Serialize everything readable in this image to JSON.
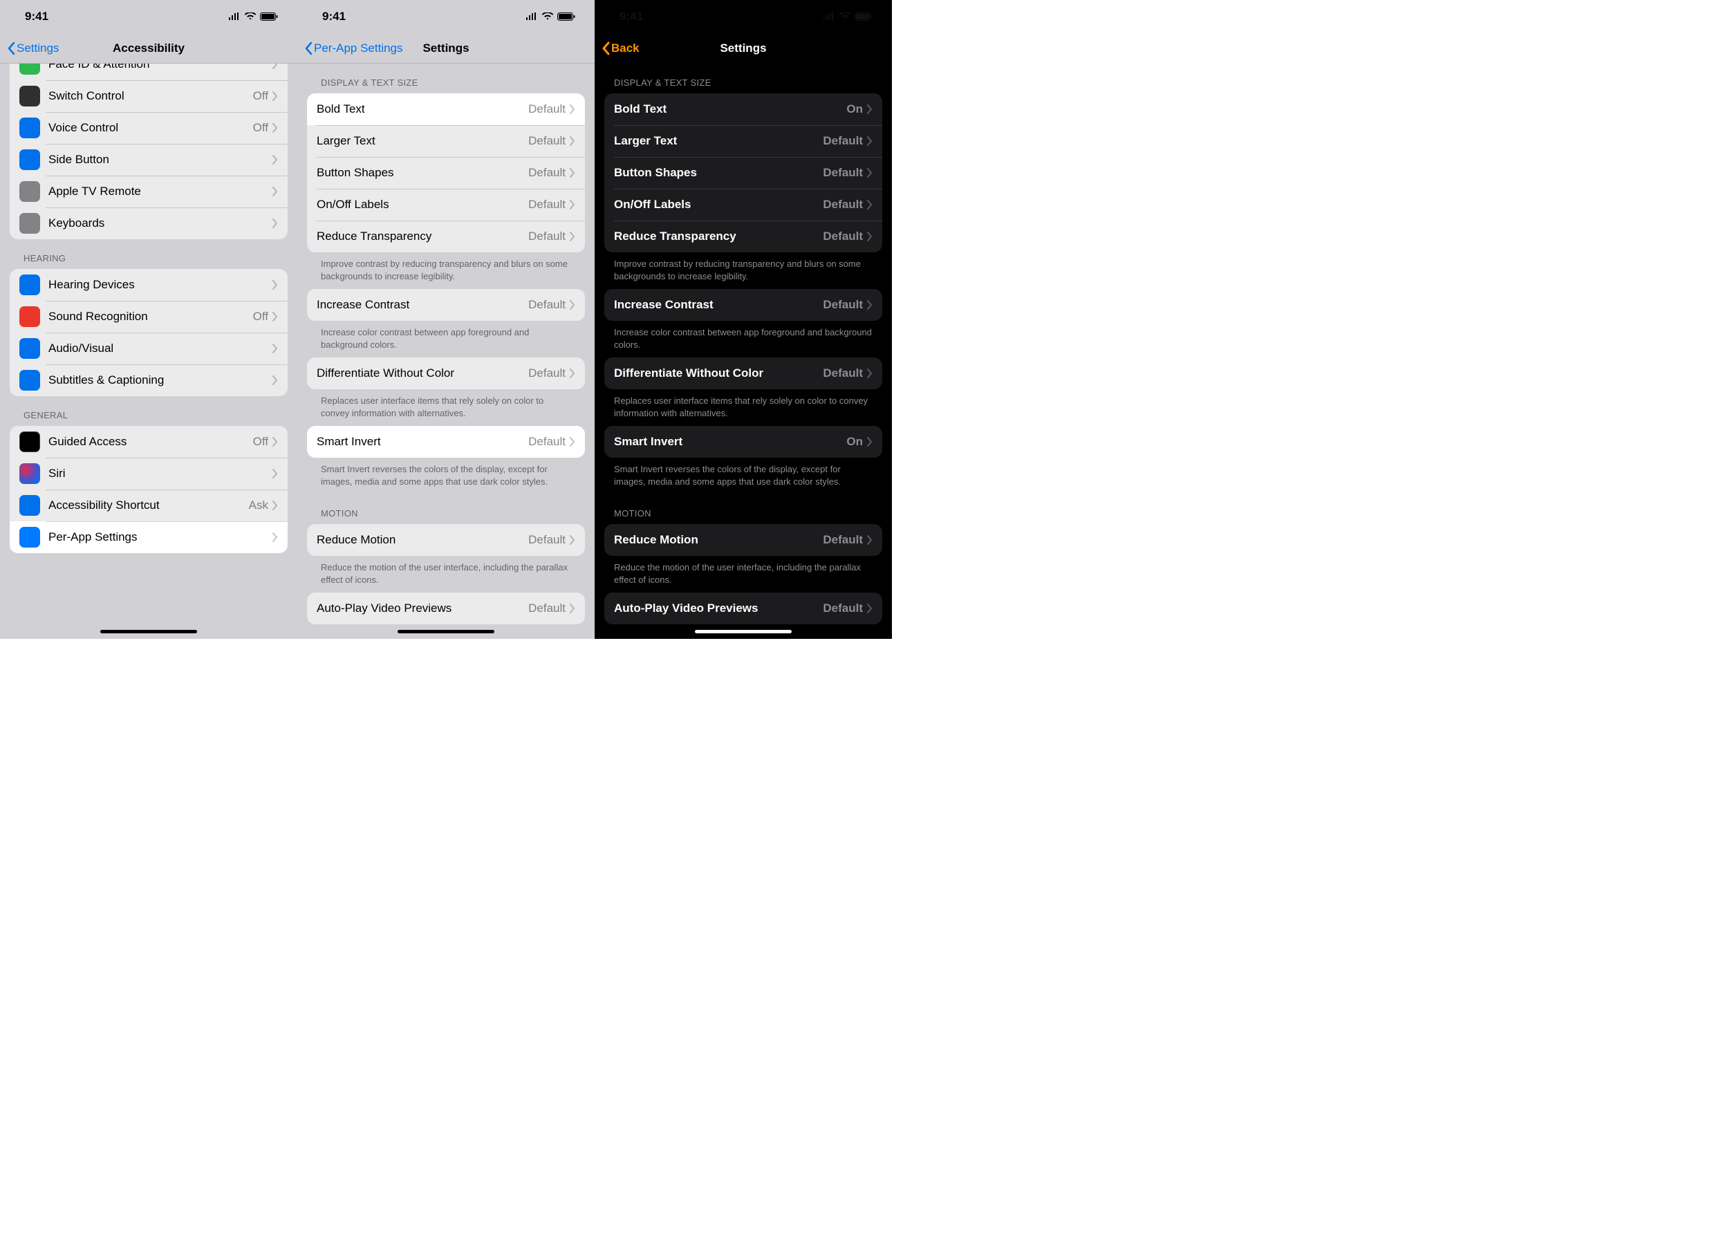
{
  "status": {
    "time": "9:41"
  },
  "panel1": {
    "back": "Settings",
    "title": "Accessibility",
    "rows_top": [
      {
        "icon": "ic-green",
        "label": "Face ID & Attention"
      },
      {
        "icon": "ic-darkgray",
        "label": "Switch Control",
        "value": "Off"
      },
      {
        "icon": "ic-blue",
        "label": "Voice Control",
        "value": "Off"
      },
      {
        "icon": "ic-blue",
        "label": "Side Button"
      },
      {
        "icon": "ic-gray",
        "label": "Apple TV Remote"
      },
      {
        "icon": "ic-gray",
        "label": "Keyboards"
      }
    ],
    "hearing_header": "HEARING",
    "rows_hearing": [
      {
        "icon": "ic-blue",
        "label": "Hearing Devices"
      },
      {
        "icon": "ic-red",
        "label": "Sound Recognition",
        "value": "Off"
      },
      {
        "icon": "ic-blue",
        "label": "Audio/Visual"
      },
      {
        "icon": "ic-blue",
        "label": "Subtitles & Captioning"
      }
    ],
    "general_header": "GENERAL",
    "rows_general": [
      {
        "icon": "ic-black",
        "label": "Guided Access",
        "value": "Off"
      },
      {
        "icon": "ic-siri",
        "label": "Siri"
      },
      {
        "icon": "ic-blue",
        "label": "Accessibility Shortcut",
        "value": "Ask"
      },
      {
        "icon": "ic-blue",
        "label": "Per-App Settings",
        "hl": true
      }
    ]
  },
  "panel2": {
    "back": "Per-App Settings",
    "title": "Settings",
    "section1_header": "DISPLAY & TEXT SIZE",
    "rows1": [
      {
        "label": "Bold Text",
        "value": "Default",
        "hl": true
      },
      {
        "label": "Larger Text",
        "value": "Default"
      },
      {
        "label": "Button Shapes",
        "value": "Default"
      },
      {
        "label": "On/Off Labels",
        "value": "Default"
      },
      {
        "label": "Reduce Transparency",
        "value": "Default"
      }
    ],
    "footer1": "Improve contrast by reducing transparency and blurs on some backgrounds to increase legibility.",
    "rows2": [
      {
        "label": "Increase Contrast",
        "value": "Default"
      }
    ],
    "footer2": "Increase color contrast between app foreground and background colors.",
    "rows3": [
      {
        "label": "Differentiate Without Color",
        "value": "Default"
      }
    ],
    "footer3": "Replaces user interface items that rely solely on color to convey information with alternatives.",
    "rows4": [
      {
        "label": "Smart Invert",
        "value": "Default",
        "hl": true
      }
    ],
    "footer4": "Smart Invert reverses the colors of the display, except for images, media and some apps that use dark color styles.",
    "motion_header": "MOTION",
    "rows5": [
      {
        "label": "Reduce Motion",
        "value": "Default"
      }
    ],
    "footer5": "Reduce the motion of the user interface, including the parallax effect of icons.",
    "rows6": [
      {
        "label": "Auto-Play Video Previews",
        "value": "Default"
      }
    ]
  },
  "panel3": {
    "back": "Back",
    "title": "Settings",
    "section1_header": "DISPLAY & TEXT SIZE",
    "rows1": [
      {
        "label": "Bold Text",
        "value": "On"
      },
      {
        "label": "Larger Text",
        "value": "Default"
      },
      {
        "label": "Button Shapes",
        "value": "Default"
      },
      {
        "label": "On/Off Labels",
        "value": "Default"
      },
      {
        "label": "Reduce Transparency",
        "value": "Default"
      }
    ],
    "footer1": "Improve contrast by reducing transparency and blurs on some backgrounds to increase legibility.",
    "rows2": [
      {
        "label": "Increase Contrast",
        "value": "Default"
      }
    ],
    "footer2": "Increase color contrast between app foreground and background colors.",
    "rows3": [
      {
        "label": "Differentiate Without Color",
        "value": "Default"
      }
    ],
    "footer3": "Replaces user interface items that rely solely on color to convey information with alternatives.",
    "rows4": [
      {
        "label": "Smart Invert",
        "value": "On"
      }
    ],
    "footer4": "Smart Invert reverses the colors of the display, except for images, media and some apps that use dark color styles.",
    "motion_header": "MOTION",
    "rows5": [
      {
        "label": "Reduce Motion",
        "value": "Default"
      }
    ],
    "footer5": "Reduce the motion of the user interface, including the parallax effect of icons.",
    "rows6": [
      {
        "label": "Auto-Play Video Previews",
        "value": "Default"
      }
    ]
  }
}
